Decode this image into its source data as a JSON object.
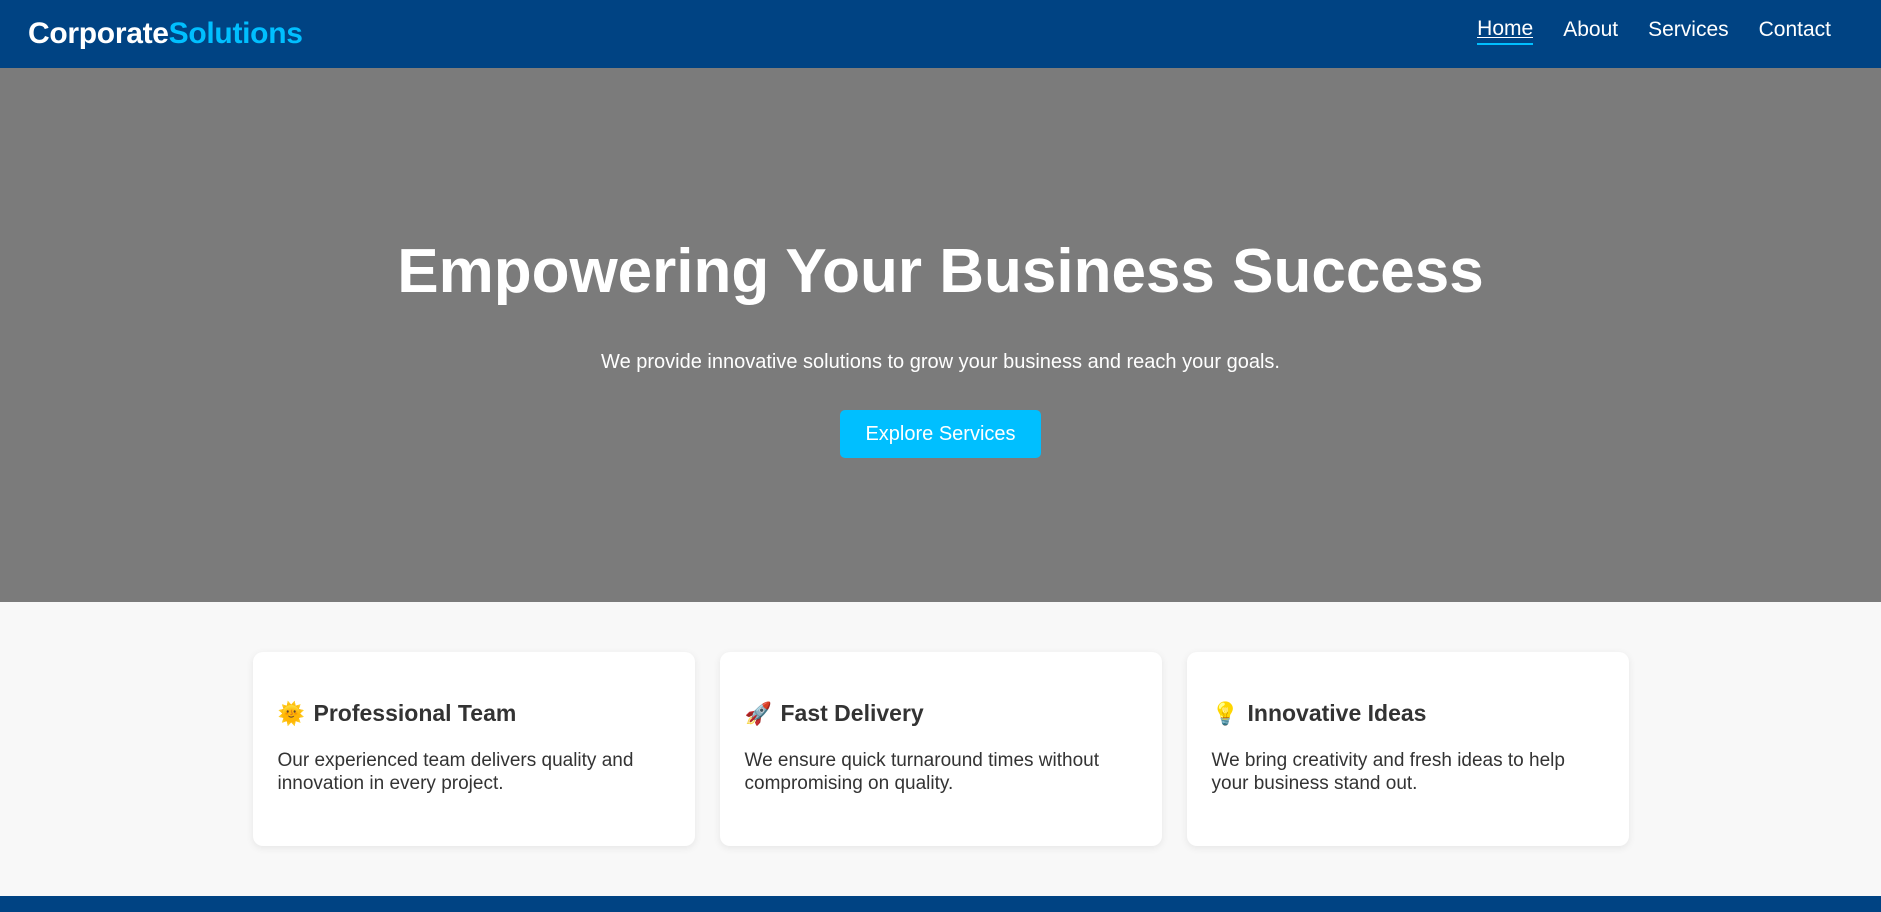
{
  "header": {
    "logo_main": "Corporate",
    "logo_accent": "Solutions",
    "nav": [
      {
        "label": "Home",
        "active": true
      },
      {
        "label": "About",
        "active": false
      },
      {
        "label": "Services",
        "active": false
      },
      {
        "label": "Contact",
        "active": false
      }
    ]
  },
  "hero": {
    "title": "Empowering Your Business Success",
    "subtitle": "We provide innovative solutions to grow your business and reach your goals.",
    "button_label": "Explore Services"
  },
  "features": [
    {
      "icon": "sun-icon",
      "icon_glyph": "🌞",
      "title": "Professional Team",
      "text": "Our experienced team delivers quality and innovation in every project."
    },
    {
      "icon": "rocket-icon",
      "icon_glyph": "🚀",
      "title": "Fast Delivery",
      "text": "We ensure quick turnaround times without compromising on quality."
    },
    {
      "icon": "lightbulb-icon",
      "icon_glyph": "💡",
      "title": "Innovative Ideas",
      "text": "We bring creativity and fresh ideas to help your business stand out."
    }
  ],
  "colors": {
    "nav_bg": "#004383",
    "accent": "#00bfff",
    "hero_bg": "#7b7b7b",
    "page_bg": "#f8f8f8"
  }
}
